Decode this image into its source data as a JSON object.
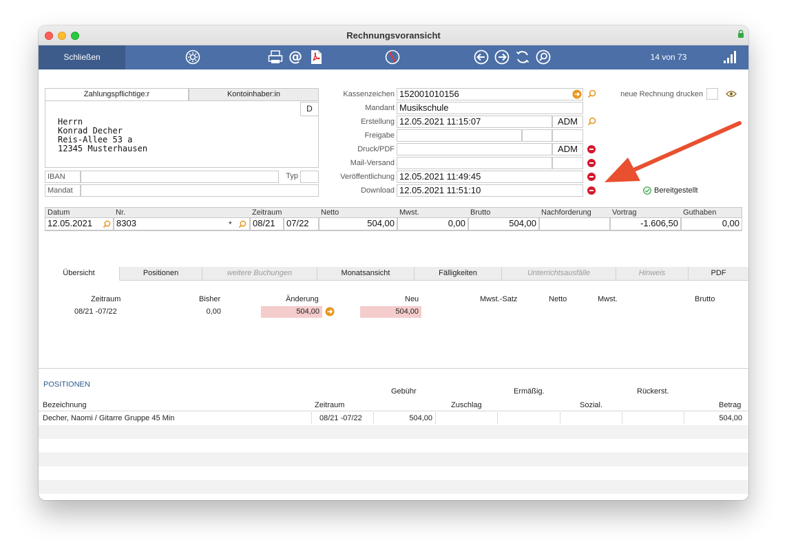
{
  "window": {
    "title": "Rechnungsvoransicht"
  },
  "toolbar": {
    "close_label": "Schließen",
    "counter": "14 von 73"
  },
  "address": {
    "tab_payer": "Zahlungspflichtige:r",
    "tab_holder": "Kontoinhaber:in",
    "flag": "D",
    "lines": [
      "Herrn",
      "Konrad Decher",
      "Reis-Allee 53 a",
      "12345 Musterhausen"
    ],
    "iban_label": "IBAN",
    "iban_value": "",
    "typ_label": "Typ",
    "typ_value": "",
    "mandat_label": "Mandat",
    "mandat_value": ""
  },
  "invoice": {
    "kassenzeichen_label": "Kassenzeichen",
    "kassenzeichen": "152001010156",
    "mandant_label": "Mandant",
    "mandant": "Musikschule",
    "erstellung_label": "Erstellung",
    "erstellung": "12.05.2021 11:15:07",
    "erstellung_user": "ADM",
    "freigabe_label": "Freigabe",
    "freigabe": "",
    "druck_label": "Druck/PDF",
    "druck": "",
    "druck_user": "ADM",
    "mail_label": "Mail-Versand",
    "mail": "",
    "veroeff_label": "Veröffentlichung",
    "veroeff": "12.05.2021 11:49:45",
    "download_label": "Download",
    "download": "12.05.2021 11:51:10",
    "print_new_label": "neue Rechnung drucken",
    "status_label": "Bereitgestellt"
  },
  "summary": {
    "headers": [
      "Datum",
      "Nr.",
      "Zeitraum",
      "Netto",
      "Mwst.",
      "Brutto",
      "Nachforderung",
      "Vortrag",
      "Guthaben"
    ],
    "datum": "12.05.2021",
    "nr": "8303",
    "nr_mark": "*",
    "zeitraum_from": "08/21",
    "zeitraum_to": "07/22",
    "netto": "504,00",
    "mwst": "0,00",
    "brutto": "504,00",
    "nachforderung": "",
    "vortrag": "-1.606,50",
    "guthaben": "0,00"
  },
  "tabs": [
    {
      "label": "Übersicht"
    },
    {
      "label": "Positionen"
    },
    {
      "label": "weitere Buchungen"
    },
    {
      "label": "Monatsansicht"
    },
    {
      "label": "Fälligkeiten"
    },
    {
      "label": "Unterrichtsausfälle"
    },
    {
      "label": "Hinweis"
    },
    {
      "label": "PDF"
    }
  ],
  "overview": {
    "headers": {
      "zeitraum": "Zeitraum",
      "bisher": "Bisher",
      "aenderung": "Änderung",
      "neu": "Neu",
      "satz": "Mwst.-Satz",
      "netto": "Netto",
      "mwst": "Mwst.",
      "brutto": "Brutto"
    },
    "row": {
      "zeitraum": "08/21 -07/22",
      "bisher": "0,00",
      "aenderung": "504,00",
      "neu": "504,00"
    }
  },
  "positions": {
    "section_title": "POSITIONEN",
    "headers_top": {
      "gebuehr": "Gebühr",
      "ermaessig": "Ermäßig.",
      "rueckerst": "Rückerst."
    },
    "headers_bottom": {
      "bezeichnung": "Bezeichnung",
      "zeitraum": "Zeitraum",
      "zuschlag": "Zuschlag",
      "sozial": "Sozial.",
      "betrag": "Betrag"
    },
    "rows": [
      {
        "bezeichnung": "Decher, Naomi / Gitarre Gruppe 45 Min",
        "zeitraum": "08/21 -07/22",
        "gebuehr": "504,00",
        "betrag": "504,00"
      }
    ]
  },
  "colors": {
    "toolbar": "#4b6fa6",
    "toolbar_dark": "#3d5c8c",
    "accent_orange": "#e8971e",
    "delete_red": "#d4182d",
    "arrow": "#e8502f",
    "highlight": "#f5cccc"
  }
}
